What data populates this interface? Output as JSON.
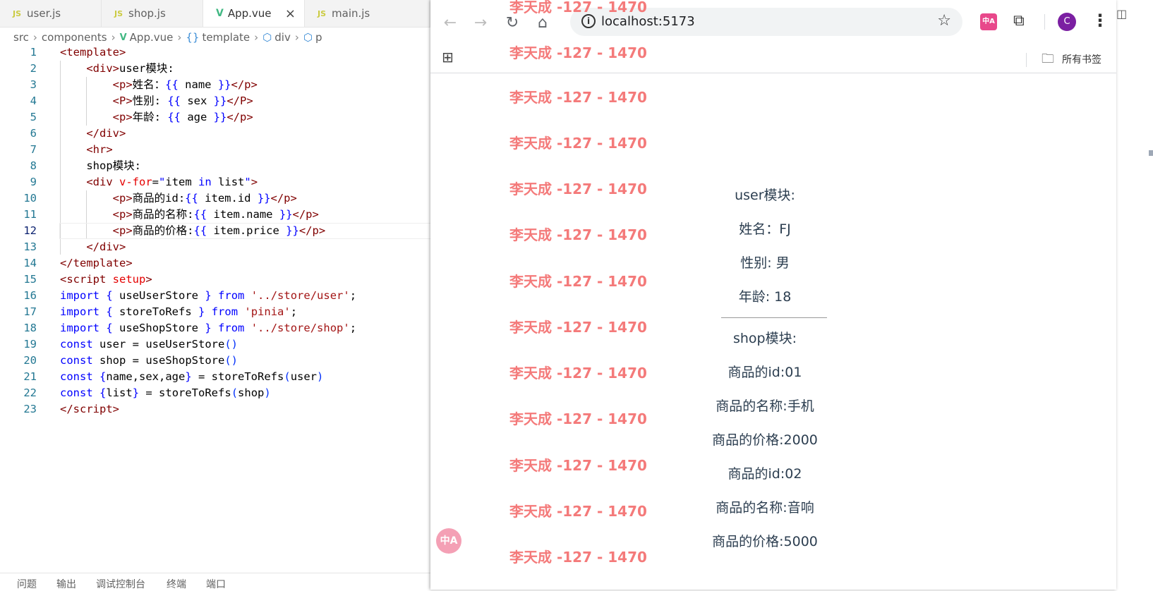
{
  "editor": {
    "tabs": [
      {
        "icon": "JS",
        "label": "user.js"
      },
      {
        "icon": "JS",
        "label": "shop.js"
      },
      {
        "icon": "V",
        "label": "App.vue"
      },
      {
        "icon": "JS",
        "label": "main.js"
      }
    ],
    "breadcrumb": [
      "src",
      "components",
      "App.vue",
      "template",
      "div",
      "p"
    ],
    "bottom_tabs": [
      "问题",
      "输出",
      "调试控制台",
      "终端",
      "端口"
    ],
    "lines": [
      "1",
      "2",
      "3",
      "4",
      "5",
      "6",
      "7",
      "8",
      "9",
      "10",
      "11",
      "12",
      "13",
      "14",
      "15",
      "16",
      "17",
      "18",
      "19",
      "20",
      "21",
      "22",
      "23"
    ],
    "current_line": "12"
  },
  "browser": {
    "url": "localhost:5173",
    "bookmarks_label": "所有书签",
    "avatar_letter": "C",
    "extension_label": "中A",
    "floating_button_label": "中A",
    "repeated_text": "李天成 -127 - 1470",
    "app": {
      "user_title": "user模块:",
      "name_line": "姓名：FJ",
      "sex_line": "性别: 男",
      "age_line": "年龄: 18",
      "shop_title": "shop模块:",
      "items": [
        {
          "id": "商品的id:01",
          "name": "商品的名称:手机",
          "price": "商品的价格:2000"
        },
        {
          "id": "商品的id:02",
          "name": "商品的名称:音响",
          "price": "商品的价格:5000"
        }
      ]
    }
  }
}
